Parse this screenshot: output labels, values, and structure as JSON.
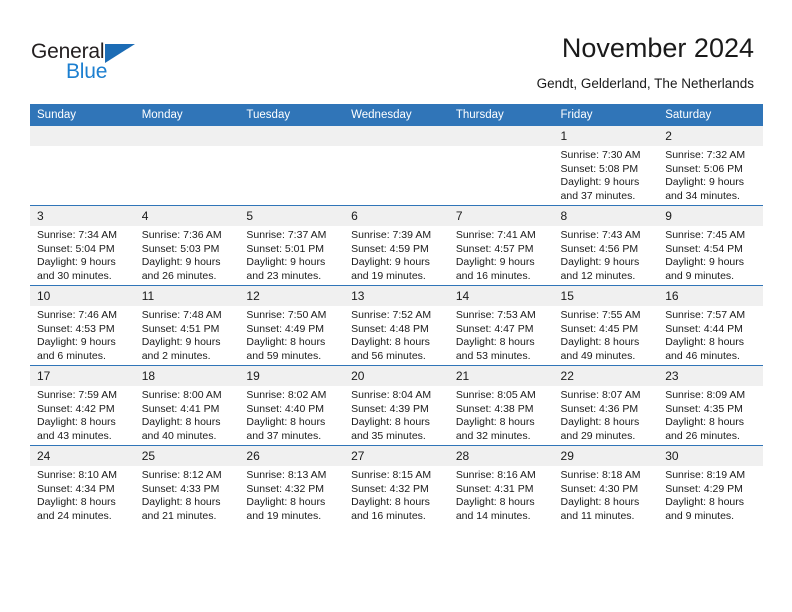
{
  "brand": {
    "name_part1": "General",
    "name_part2": "Blue",
    "triangle_icon": "triangle-icon",
    "accent_color": "#1c7fd0"
  },
  "header": {
    "title": "November 2024",
    "subtitle": "Gendt, Gelderland, The Netherlands"
  },
  "theme": {
    "header_blue": "#3075b8",
    "daynum_strip": "#f0f0f0",
    "text": "#1a1a1a"
  },
  "calendar": {
    "weekday_headers": [
      "Sunday",
      "Monday",
      "Tuesday",
      "Wednesday",
      "Thursday",
      "Friday",
      "Saturday"
    ],
    "weeks": [
      [
        {
          "day": "",
          "sunrise": "",
          "sunset": "",
          "daylight": "",
          "empty": true
        },
        {
          "day": "",
          "sunrise": "",
          "sunset": "",
          "daylight": "",
          "empty": true
        },
        {
          "day": "",
          "sunrise": "",
          "sunset": "",
          "daylight": "",
          "empty": true
        },
        {
          "day": "",
          "sunrise": "",
          "sunset": "",
          "daylight": "",
          "empty": true
        },
        {
          "day": "",
          "sunrise": "",
          "sunset": "",
          "daylight": "",
          "empty": true
        },
        {
          "day": "1",
          "sunrise": "Sunrise: 7:30 AM",
          "sunset": "Sunset: 5:08 PM",
          "daylight": "Daylight: 9 hours and 37 minutes.",
          "empty": false
        },
        {
          "day": "2",
          "sunrise": "Sunrise: 7:32 AM",
          "sunset": "Sunset: 5:06 PM",
          "daylight": "Daylight: 9 hours and 34 minutes.",
          "empty": false
        }
      ],
      [
        {
          "day": "3",
          "sunrise": "Sunrise: 7:34 AM",
          "sunset": "Sunset: 5:04 PM",
          "daylight": "Daylight: 9 hours and 30 minutes.",
          "empty": false
        },
        {
          "day": "4",
          "sunrise": "Sunrise: 7:36 AM",
          "sunset": "Sunset: 5:03 PM",
          "daylight": "Daylight: 9 hours and 26 minutes.",
          "empty": false
        },
        {
          "day": "5",
          "sunrise": "Sunrise: 7:37 AM",
          "sunset": "Sunset: 5:01 PM",
          "daylight": "Daylight: 9 hours and 23 minutes.",
          "empty": false
        },
        {
          "day": "6",
          "sunrise": "Sunrise: 7:39 AM",
          "sunset": "Sunset: 4:59 PM",
          "daylight": "Daylight: 9 hours and 19 minutes.",
          "empty": false
        },
        {
          "day": "7",
          "sunrise": "Sunrise: 7:41 AM",
          "sunset": "Sunset: 4:57 PM",
          "daylight": "Daylight: 9 hours and 16 minutes.",
          "empty": false
        },
        {
          "day": "8",
          "sunrise": "Sunrise: 7:43 AM",
          "sunset": "Sunset: 4:56 PM",
          "daylight": "Daylight: 9 hours and 12 minutes.",
          "empty": false
        },
        {
          "day": "9",
          "sunrise": "Sunrise: 7:45 AM",
          "sunset": "Sunset: 4:54 PM",
          "daylight": "Daylight: 9 hours and 9 minutes.",
          "empty": false
        }
      ],
      [
        {
          "day": "10",
          "sunrise": "Sunrise: 7:46 AM",
          "sunset": "Sunset: 4:53 PM",
          "daylight": "Daylight: 9 hours and 6 minutes.",
          "empty": false
        },
        {
          "day": "11",
          "sunrise": "Sunrise: 7:48 AM",
          "sunset": "Sunset: 4:51 PM",
          "daylight": "Daylight: 9 hours and 2 minutes.",
          "empty": false
        },
        {
          "day": "12",
          "sunrise": "Sunrise: 7:50 AM",
          "sunset": "Sunset: 4:49 PM",
          "daylight": "Daylight: 8 hours and 59 minutes.",
          "empty": false
        },
        {
          "day": "13",
          "sunrise": "Sunrise: 7:52 AM",
          "sunset": "Sunset: 4:48 PM",
          "daylight": "Daylight: 8 hours and 56 minutes.",
          "empty": false
        },
        {
          "day": "14",
          "sunrise": "Sunrise: 7:53 AM",
          "sunset": "Sunset: 4:47 PM",
          "daylight": "Daylight: 8 hours and 53 minutes.",
          "empty": false
        },
        {
          "day": "15",
          "sunrise": "Sunrise: 7:55 AM",
          "sunset": "Sunset: 4:45 PM",
          "daylight": "Daylight: 8 hours and 49 minutes.",
          "empty": false
        },
        {
          "day": "16",
          "sunrise": "Sunrise: 7:57 AM",
          "sunset": "Sunset: 4:44 PM",
          "daylight": "Daylight: 8 hours and 46 minutes.",
          "empty": false
        }
      ],
      [
        {
          "day": "17",
          "sunrise": "Sunrise: 7:59 AM",
          "sunset": "Sunset: 4:42 PM",
          "daylight": "Daylight: 8 hours and 43 minutes.",
          "empty": false
        },
        {
          "day": "18",
          "sunrise": "Sunrise: 8:00 AM",
          "sunset": "Sunset: 4:41 PM",
          "daylight": "Daylight: 8 hours and 40 minutes.",
          "empty": false
        },
        {
          "day": "19",
          "sunrise": "Sunrise: 8:02 AM",
          "sunset": "Sunset: 4:40 PM",
          "daylight": "Daylight: 8 hours and 37 minutes.",
          "empty": false
        },
        {
          "day": "20",
          "sunrise": "Sunrise: 8:04 AM",
          "sunset": "Sunset: 4:39 PM",
          "daylight": "Daylight: 8 hours and 35 minutes.",
          "empty": false
        },
        {
          "day": "21",
          "sunrise": "Sunrise: 8:05 AM",
          "sunset": "Sunset: 4:38 PM",
          "daylight": "Daylight: 8 hours and 32 minutes.",
          "empty": false
        },
        {
          "day": "22",
          "sunrise": "Sunrise: 8:07 AM",
          "sunset": "Sunset: 4:36 PM",
          "daylight": "Daylight: 8 hours and 29 minutes.",
          "empty": false
        },
        {
          "day": "23",
          "sunrise": "Sunrise: 8:09 AM",
          "sunset": "Sunset: 4:35 PM",
          "daylight": "Daylight: 8 hours and 26 minutes.",
          "empty": false
        }
      ],
      [
        {
          "day": "24",
          "sunrise": "Sunrise: 8:10 AM",
          "sunset": "Sunset: 4:34 PM",
          "daylight": "Daylight: 8 hours and 24 minutes.",
          "empty": false
        },
        {
          "day": "25",
          "sunrise": "Sunrise: 8:12 AM",
          "sunset": "Sunset: 4:33 PM",
          "daylight": "Daylight: 8 hours and 21 minutes.",
          "empty": false
        },
        {
          "day": "26",
          "sunrise": "Sunrise: 8:13 AM",
          "sunset": "Sunset: 4:32 PM",
          "daylight": "Daylight: 8 hours and 19 minutes.",
          "empty": false
        },
        {
          "day": "27",
          "sunrise": "Sunrise: 8:15 AM",
          "sunset": "Sunset: 4:32 PM",
          "daylight": "Daylight: 8 hours and 16 minutes.",
          "empty": false
        },
        {
          "day": "28",
          "sunrise": "Sunrise: 8:16 AM",
          "sunset": "Sunset: 4:31 PM",
          "daylight": "Daylight: 8 hours and 14 minutes.",
          "empty": false
        },
        {
          "day": "29",
          "sunrise": "Sunrise: 8:18 AM",
          "sunset": "Sunset: 4:30 PM",
          "daylight": "Daylight: 8 hours and 11 minutes.",
          "empty": false
        },
        {
          "day": "30",
          "sunrise": "Sunrise: 8:19 AM",
          "sunset": "Sunset: 4:29 PM",
          "daylight": "Daylight: 8 hours and 9 minutes.",
          "empty": false
        }
      ]
    ]
  }
}
